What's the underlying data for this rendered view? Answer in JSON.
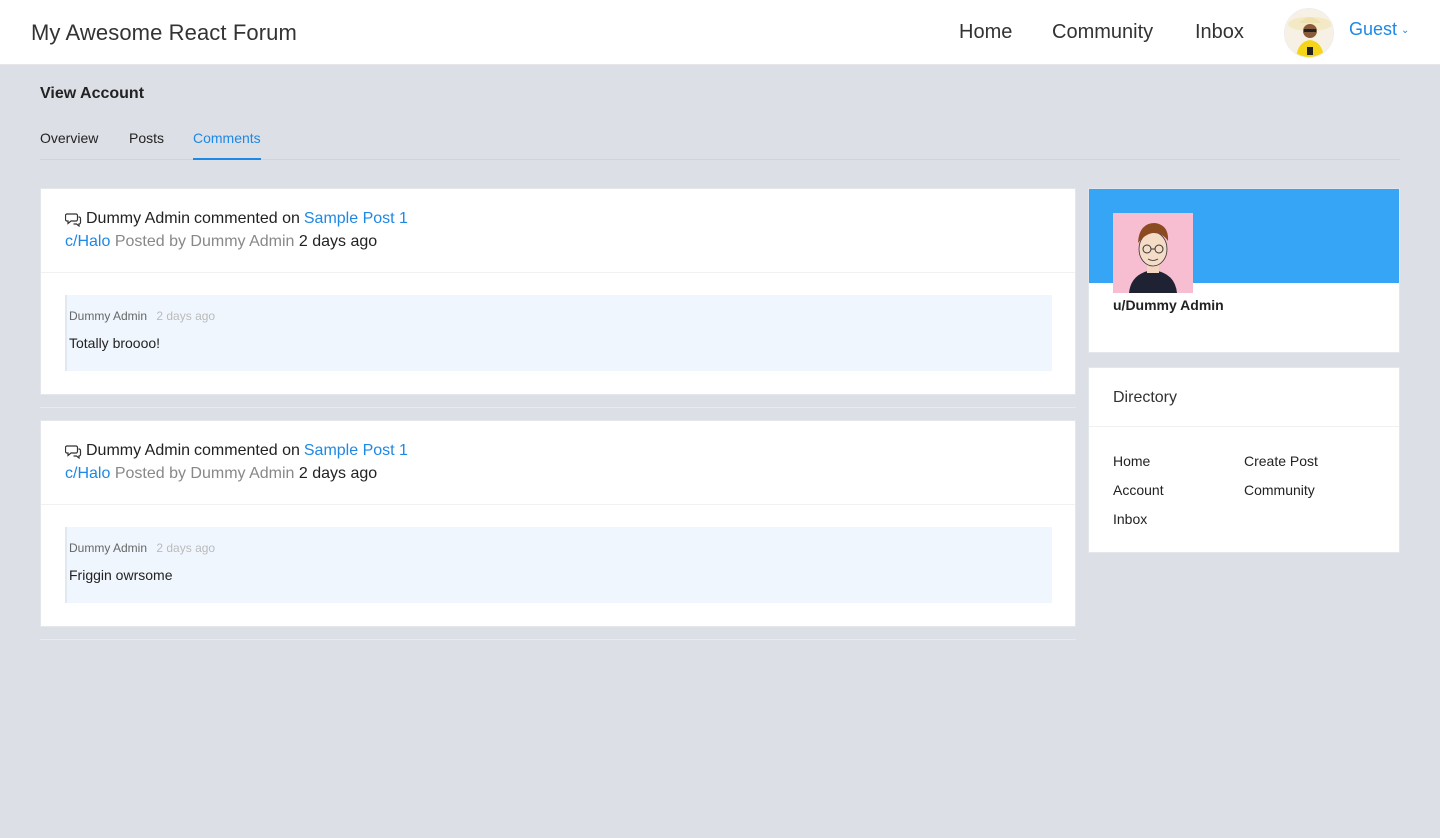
{
  "header": {
    "brand": "My Awesome React Forum",
    "nav": [
      "Home",
      "Community",
      "Inbox"
    ],
    "user_label": "Guest"
  },
  "page": {
    "title": "View Account",
    "tabs": [
      "Overview",
      "Posts",
      "Comments"
    ],
    "active_tab": "Comments"
  },
  "comments": [
    {
      "author": "Dummy Admin",
      "action": "commented on",
      "post_title": "Sample Post 1",
      "community": "c/Halo",
      "posted_by_label": "Posted by",
      "post_author": "Dummy Admin",
      "post_time": "2 days ago",
      "comment_author": "Dummy Admin",
      "comment_time": "2 days ago",
      "comment_body": "Totally broooo!"
    },
    {
      "author": "Dummy Admin",
      "action": "commented on",
      "post_title": "Sample Post 1",
      "community": "c/Halo",
      "posted_by_label": "Posted by",
      "post_author": "Dummy Admin",
      "post_time": "2 days ago",
      "comment_author": "Dummy Admin",
      "comment_time": "2 days ago",
      "comment_body": "Friggin owrsome"
    }
  ],
  "profile": {
    "username": "u/Dummy Admin"
  },
  "directory": {
    "title": "Directory",
    "links": [
      "Home",
      "Create Post",
      "Account",
      "Community",
      "Inbox"
    ]
  },
  "colors": {
    "accent": "#1e88e5",
    "banner": "#36a5f5",
    "background": "#dcdfe5"
  },
  "icons": {
    "comment": "speech-bubbles-icon",
    "dropdown": "chevron-down-icon"
  }
}
